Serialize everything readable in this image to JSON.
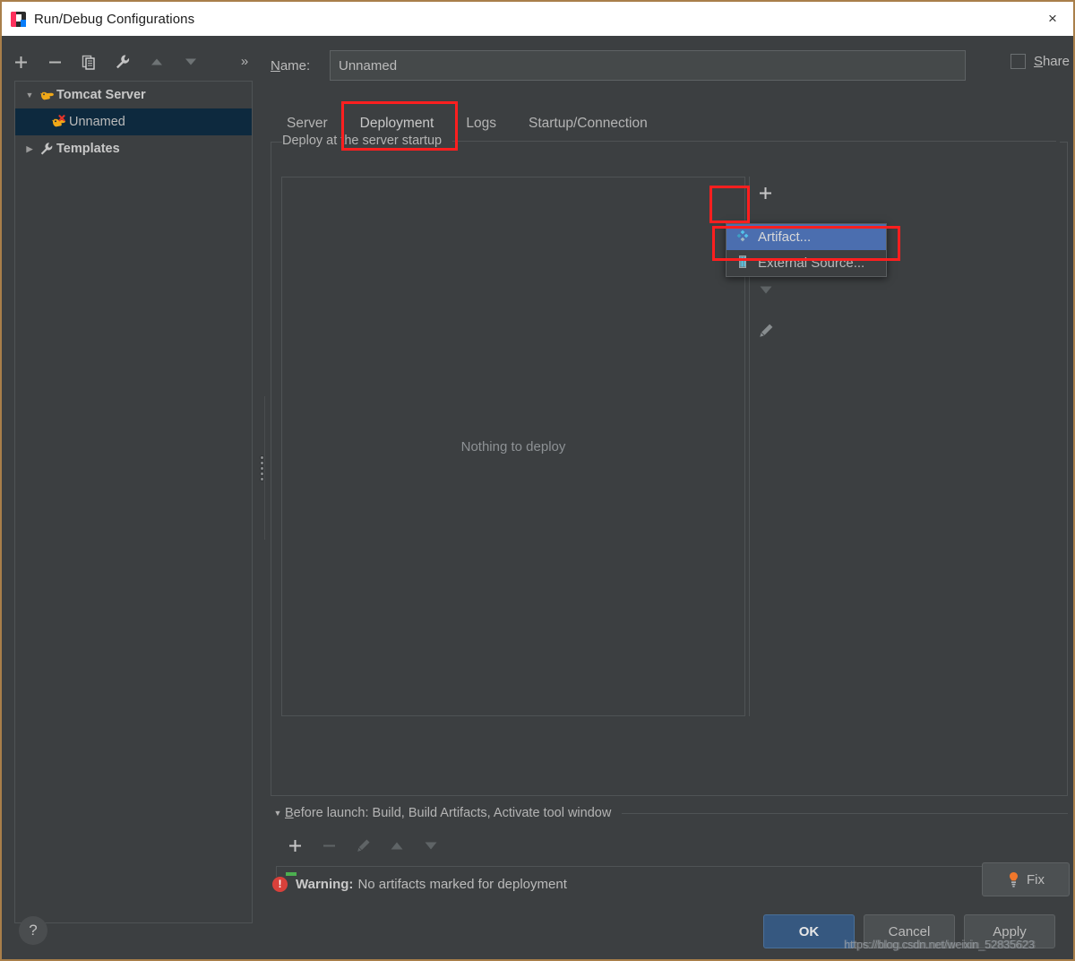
{
  "window": {
    "title": "Run/Debug Configurations",
    "app_icon": "intellij-idea-icon",
    "close_label": "×"
  },
  "sidebar": {
    "toolbar": [
      {
        "name": "add-configuration-button",
        "icon": "plus-icon"
      },
      {
        "name": "remove-configuration-button",
        "icon": "minus-icon"
      },
      {
        "name": "copy-configuration-button",
        "icon": "copy-icon"
      },
      {
        "name": "edit-templates-button",
        "icon": "wrench-icon"
      },
      {
        "name": "move-up-button",
        "icon": "arrow-up-icon"
      },
      {
        "name": "move-down-button",
        "icon": "arrow-down-icon"
      }
    ],
    "overflow_label": "»",
    "tree": [
      {
        "label": "Tomcat Server",
        "icon": "tomcat-icon",
        "expander": "▼",
        "selected": false,
        "bold": true,
        "indent": 0
      },
      {
        "label": "Unnamed",
        "icon": "tomcat-error-icon",
        "expander": "",
        "selected": true,
        "bold": false,
        "indent": 1
      },
      {
        "label": "Templates",
        "icon": "wrench-icon",
        "expander": "▶",
        "selected": false,
        "bold": true,
        "indent": 0
      }
    ]
  },
  "main": {
    "name_label": "Name:",
    "name_label_mnemonic": "N",
    "name_label_rest": "ame:",
    "name_value": "Unnamed",
    "share_label": "Share",
    "share_mnemonic": "S",
    "share_rest": "hare",
    "share_checked": false,
    "tabs": [
      {
        "label": "Server",
        "active": false
      },
      {
        "label": "Deployment",
        "active": true
      },
      {
        "label": "Logs",
        "active": false
      },
      {
        "label": "Startup/Connection",
        "active": false
      }
    ],
    "group_label": "Deploy at the server startup",
    "empty_text": "Nothing to deploy",
    "list_toolbar": [
      {
        "name": "add-deployment-button",
        "icon": "plus-icon"
      },
      {
        "name": "move-artifact-up-button",
        "icon": "arrow-up-icon"
      },
      {
        "name": "move-artifact-down-button",
        "icon": "arrow-down-icon"
      },
      {
        "name": "edit-artifact-button",
        "icon": "pencil-icon"
      }
    ],
    "menu": {
      "items": [
        {
          "label": "Artifact...",
          "icon": "artifact-diamond-icon",
          "selected": true
        },
        {
          "label": "External Source...",
          "icon": "external-source-icon",
          "selected": false
        }
      ]
    }
  },
  "before_launch": {
    "title": "Before launch: Build, Build Artifacts, Activate tool window",
    "title_mnemonic": "B",
    "title_rest": "efore launch: Build, Build Artifacts, Activate tool window",
    "expander": "▼",
    "toolbar": [
      {
        "name": "add-before-launch-task-button",
        "icon": "plus-icon"
      },
      {
        "name": "remove-before-launch-task-button",
        "icon": "minus-icon"
      },
      {
        "name": "edit-before-launch-task-button",
        "icon": "pencil-icon"
      },
      {
        "name": "before-launch-move-up-button",
        "icon": "arrow-up-icon"
      },
      {
        "name": "before-launch-move-down-button",
        "icon": "arrow-down-icon"
      }
    ]
  },
  "status": {
    "warning_prefix": "Warning:",
    "warning_text": "No artifacts marked for deployment",
    "warning_icon": "error-circle-icon",
    "fix_label": "Fix",
    "fix_icon": "warning-bulb-icon"
  },
  "footer": {
    "help_label": "?",
    "buttons": [
      {
        "label": "OK",
        "primary": true,
        "name": "ok-button"
      },
      {
        "label": "Cancel",
        "primary": false,
        "name": "cancel-button"
      },
      {
        "label": "Apply",
        "primary": false,
        "name": "apply-button"
      }
    ]
  },
  "watermark": "https://blog.csdn.net/weixin_52835623",
  "colors": {
    "accent_blue": "#3d87d6",
    "selection_blue": "#4b6eaf",
    "tree_selection": "#0d293e",
    "primary_button": "#365880",
    "annotation_red": "#ff1f1f",
    "warning_red": "#d9413b",
    "panel_bg": "#3c3f41",
    "window_border": "#a97f4a"
  }
}
